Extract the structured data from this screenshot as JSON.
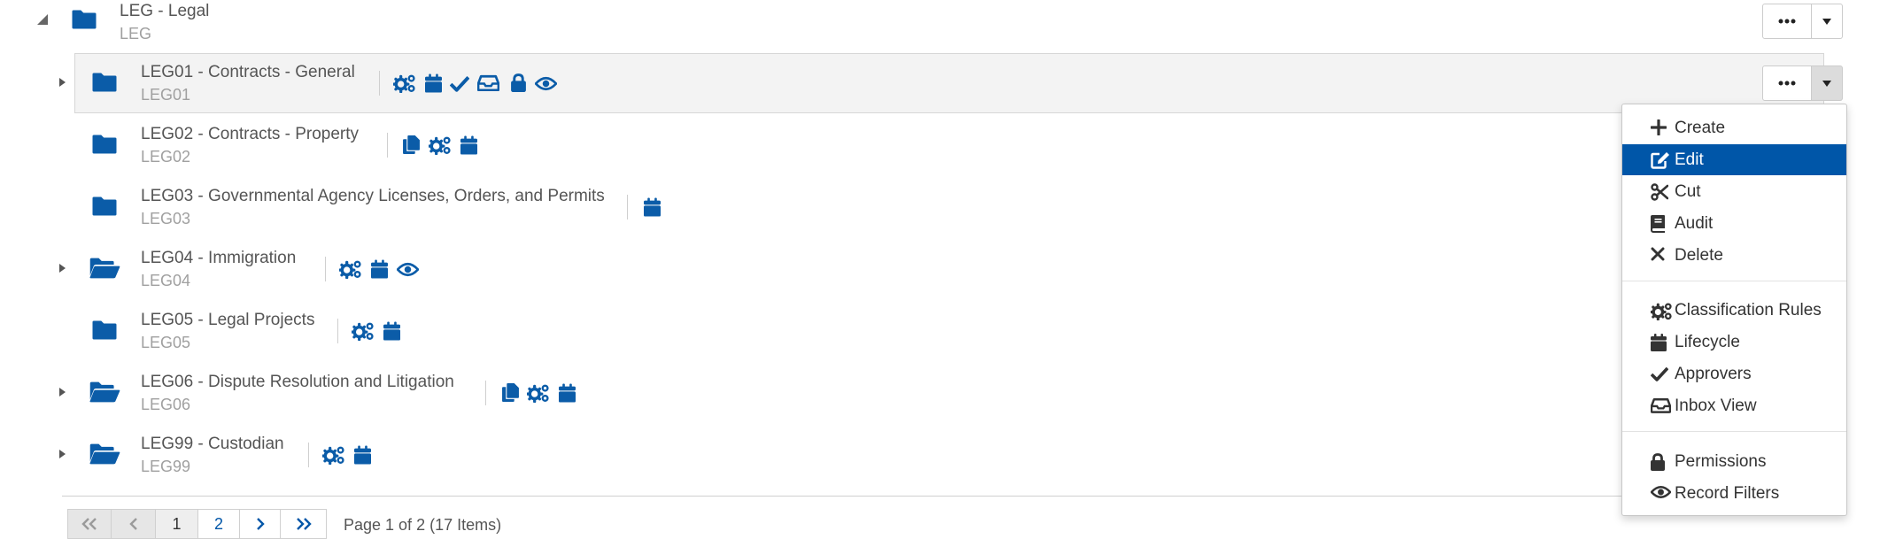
{
  "colors": {
    "accent": "#0056a8",
    "icon_blue": "#0b5ca8",
    "menu_active_bg": "#0056a8"
  },
  "root": {
    "title": "LEG - Legal",
    "code": "LEG"
  },
  "rows": [
    {
      "title": "LEG01 - Contracts - General",
      "code": "LEG01",
      "icons": [
        "gears-icon",
        "calendar-icon",
        "check-icon",
        "inbox-icon",
        "lock-icon",
        "eye-icon"
      ]
    },
    {
      "title": "LEG02 - Contracts - Property",
      "code": "LEG02",
      "icons": [
        "copy-icon",
        "gears-icon",
        "calendar-icon"
      ]
    },
    {
      "title": "LEG03 - Governmental Agency Licenses, Orders, and Permits",
      "code": "LEG03",
      "icons": [
        "calendar-icon"
      ]
    },
    {
      "title": "LEG04 - Immigration",
      "code": "LEG04",
      "icons": [
        "gears-icon",
        "calendar-icon",
        "eye-icon"
      ]
    },
    {
      "title": "LEG05 - Legal Projects",
      "code": "LEG05",
      "icons": [
        "gears-icon",
        "calendar-icon"
      ]
    },
    {
      "title": "LEG06 - Dispute Resolution and Litigation",
      "code": "LEG06",
      "icons": [
        "copy-icon",
        "gears-icon",
        "calendar-icon"
      ]
    },
    {
      "title": "LEG99 - Custodian",
      "code": "LEG99",
      "icons": [
        "gears-icon",
        "calendar-icon"
      ]
    }
  ],
  "actions": {
    "more_label": "•••"
  },
  "menu": {
    "items": [
      {
        "label": "Create",
        "icon": "plus-icon"
      },
      {
        "label": "Edit",
        "icon": "edit-icon",
        "active": true
      },
      {
        "label": "Cut",
        "icon": "scissors-icon"
      },
      {
        "label": "Audit",
        "icon": "book-icon"
      },
      {
        "label": "Delete",
        "icon": "times-icon"
      },
      {
        "label": "Classification Rules",
        "icon": "gears-icon"
      },
      {
        "label": "Lifecycle",
        "icon": "calendar-icon"
      },
      {
        "label": "Approvers",
        "icon": "check-icon"
      },
      {
        "label": "Inbox View",
        "icon": "inbox-icon"
      },
      {
        "label": "Permissions",
        "icon": "lock-icon"
      },
      {
        "label": "Record Filters",
        "icon": "eye-icon"
      }
    ]
  },
  "pager": {
    "pages": [
      "1",
      "2"
    ],
    "current_page": "1",
    "info": "Page 1 of 2 (17 Items)"
  }
}
